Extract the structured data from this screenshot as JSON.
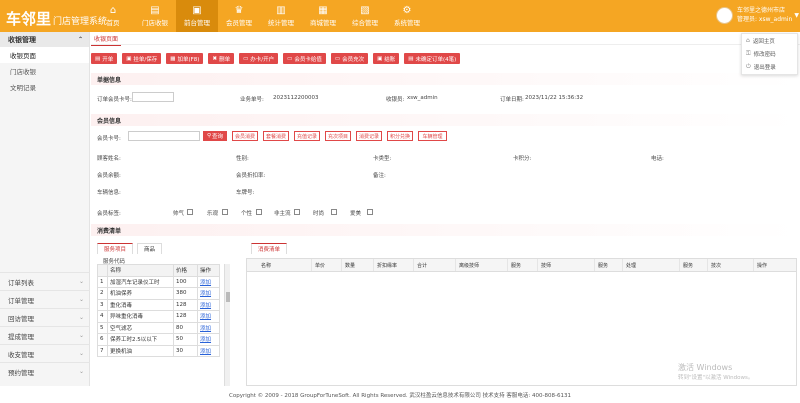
{
  "brand": {
    "title": "车邻里",
    "subtitle": "门店管理系统"
  },
  "nav": [
    {
      "label": "首页",
      "icon": "home-icon",
      "glyph": "⌂"
    },
    {
      "label": "门店收银",
      "icon": "cashier-icon",
      "glyph": "▤"
    },
    {
      "label": "前台管理",
      "icon": "desk-icon",
      "glyph": "▣"
    },
    {
      "label": "会员管理",
      "icon": "crown-icon",
      "glyph": "♛"
    },
    {
      "label": "统计管理",
      "icon": "chart-icon",
      "glyph": "▥"
    },
    {
      "label": "商城管理",
      "icon": "shop-icon",
      "glyph": "▦"
    },
    {
      "label": "综合管理",
      "icon": "grid-icon",
      "glyph": "▧"
    },
    {
      "label": "系统管理",
      "icon": "settings-icon",
      "glyph": "⚙"
    }
  ],
  "user": {
    "store": "车邻里之德州市店",
    "role": "管理员: xsw_admin",
    "menu": [
      "返回主页",
      "修改密码",
      "退出登录"
    ]
  },
  "sidebar": {
    "head": "收银管理",
    "items": [
      "收银页面",
      "门店收银",
      "文明记录"
    ],
    "groups": [
      "订单列表",
      "订单管理",
      "回访管理",
      "提成管理",
      "收支管理",
      "预约管理"
    ]
  },
  "page_tab": "收银页面",
  "toolbar": [
    "开单",
    "挂单/保存",
    "加单(F8)",
    "删单",
    "办卡/开户",
    "会员卡给值",
    "会员充次",
    "结账",
    "未确定订单(4笔)"
  ],
  "order_info": {
    "title": "单据信息",
    "member_label": "订单会员卡号:",
    "order_no_label": "业务单号:",
    "order_no": "2023112200003",
    "cashier_label": "收银员:",
    "cashier": "xsw_admin",
    "date_label": "订单日期:",
    "date": "2023/11/22 15:36:32"
  },
  "member": {
    "title": "会员信息",
    "card_label": "会员卡号:",
    "query": "查询",
    "actions": [
      "会员消费",
      "套餐消费",
      "充值记录",
      "充次项目",
      "消费记录",
      "积分兑换",
      "车辆管理"
    ],
    "fields": [
      "顾客姓名:",
      "性别:",
      "卡类型:",
      "卡积分:",
      "电话:",
      "会员余额:",
      "会员折扣率:",
      "备注:",
      "车辆信息:",
      "车牌号:"
    ],
    "tags_label": "会员标签:",
    "tags": [
      "帅气",
      "乐观",
      "个性",
      "非主流",
      "时尚",
      "爱美"
    ]
  },
  "consume": {
    "title": "消费清单",
    "left_tabs": [
      "服务项目",
      "商品"
    ],
    "code_label": "服务代码",
    "columns": [
      "名称",
      "价格",
      "操作"
    ],
    "rows": [
      {
        "no": "1",
        "name": "加湿汽车记录仪工时",
        "price": "100",
        "op": "添加"
      },
      {
        "no": "2",
        "name": "机油保养",
        "price": "380",
        "op": "添加"
      },
      {
        "no": "3",
        "name": "重化消毒",
        "price": "128",
        "op": "添加"
      },
      {
        "no": "4",
        "name": "异味重化消毒",
        "price": "128",
        "op": "添加"
      },
      {
        "no": "5",
        "name": "空气滤芯",
        "price": "80",
        "op": "添加"
      },
      {
        "no": "6",
        "name": "保养工时2.5以以下",
        "price": "50",
        "op": "添加"
      },
      {
        "no": "7",
        "name": "更换机油",
        "price": "30",
        "op": "添加"
      }
    ],
    "bill_tab": "消费清单",
    "bill_columns": [
      "名称",
      "单价",
      "数量",
      "折扣缘率",
      "合计",
      "离级技师",
      "服务",
      "技师",
      "服务",
      "处理",
      "服务",
      "技次",
      "操作"
    ]
  },
  "footer": "Copyright © 2009 - 2018 GroupForTuneSoft. All Rights Reserved. 武汉柱盈云信息技术有限公司 技术支持 客服电话: 400-808-6131",
  "watermark": {
    "line1": "激活 Windows",
    "line2": "转到\"设置\"以激活 Windows。"
  }
}
